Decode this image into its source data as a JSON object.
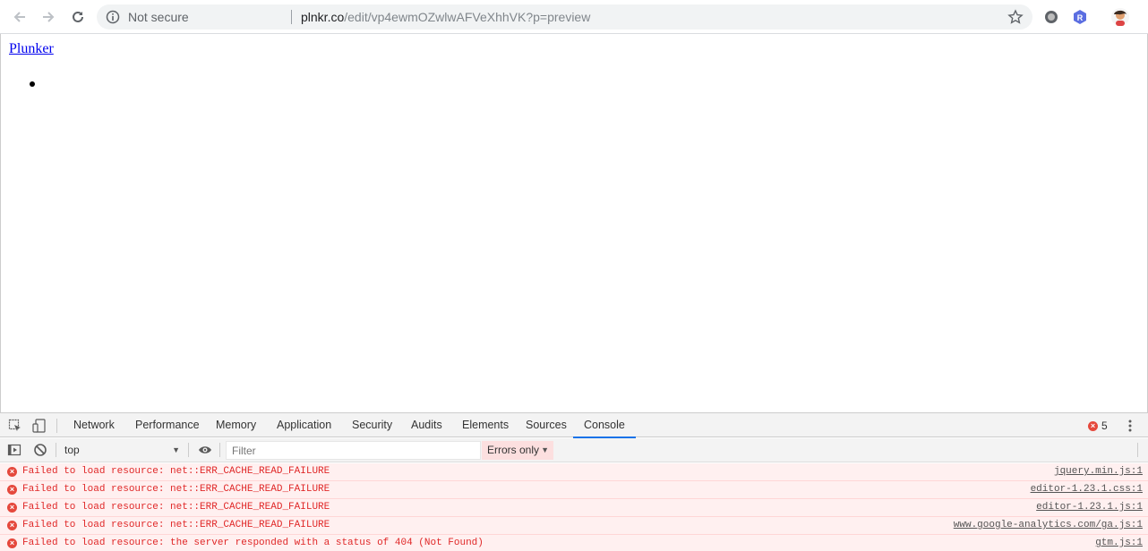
{
  "browser": {
    "security_label": "Not secure",
    "url_host": "plnkr.co",
    "url_path": "/edit/vp4ewmOZwlwAFVeXhhVK?p=preview",
    "icons": [
      "back-arrow-icon",
      "forward-arrow-icon",
      "reload-icon",
      "info-icon",
      "bookmark-star-icon",
      "extension-circle-icon",
      "extension-r-icon",
      "profile-avatar-icon"
    ]
  },
  "page": {
    "link_text": "Plunker"
  },
  "devtools": {
    "tabs": [
      "Network",
      "Performance",
      "Memory",
      "Application",
      "Security",
      "Audits",
      "Elements",
      "Sources",
      "Console"
    ],
    "active_tab": "Console",
    "error_count": "5",
    "context": "top",
    "filter_placeholder": "Filter",
    "levels": "Errors only",
    "messages": [
      {
        "text": "Failed to load resource: net::ERR_CACHE_READ_FAILURE",
        "source": "jquery.min.js:1"
      },
      {
        "text": "Failed to load resource: net::ERR_CACHE_READ_FAILURE",
        "source": "editor-1.23.1.css:1"
      },
      {
        "text": "Failed to load resource: net::ERR_CACHE_READ_FAILURE",
        "source": "editor-1.23.1.js:1"
      },
      {
        "text": "Failed to load resource: net::ERR_CACHE_READ_FAILURE",
        "source": "www.google-analytics.com/ga.js:1"
      },
      {
        "text": "Failed to load resource: the server responded with a status of 404 (Not Found)",
        "source": "gtm.js:1"
      }
    ],
    "colors": {
      "error_text": "#e02828",
      "error_bg": "#fff0f0",
      "active_tab_underline": "#1a73e8"
    }
  }
}
